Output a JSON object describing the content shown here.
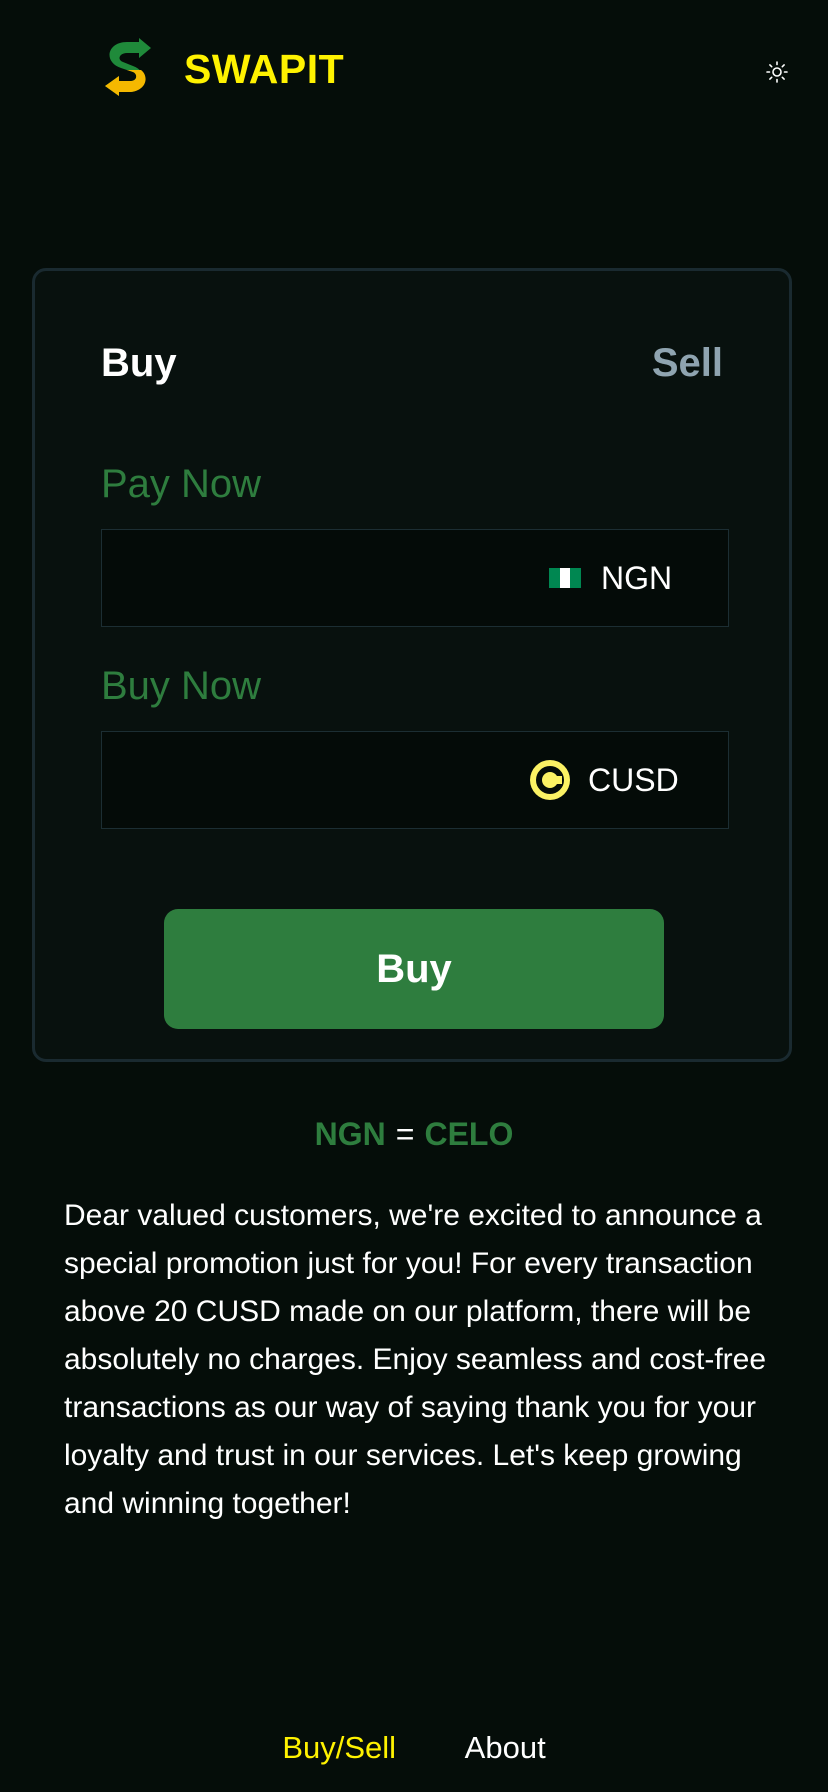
{
  "header": {
    "brand": "SWAPIT",
    "logo_icon": "swap-s-logo-icon",
    "theme_icon": "sun-icon"
  },
  "tabs": [
    {
      "label": "Buy",
      "active": true
    },
    {
      "label": "Sell",
      "active": false
    }
  ],
  "pay_field": {
    "label": "Pay Now",
    "value": "",
    "currency": "NGN",
    "currency_icon": "nigeria-flag-icon"
  },
  "receive_field": {
    "label": "Buy Now",
    "value": "",
    "currency": "CUSD",
    "currency_icon": "cusd-coin-icon"
  },
  "action_button": {
    "label": "Buy"
  },
  "rate": {
    "from": "NGN",
    "equals": "=",
    "to": "CELO"
  },
  "promo_text": "Dear valued customers, we're excited to announce a special promotion just for you! For every transaction above 20 CUSD made on our platform, there will be absolutely no charges. Enjoy seamless and cost-free transactions as our way of saying thank you for your loyalty and trust in our services. Let's keep growing and winning together!",
  "footer_nav": [
    {
      "label": "Buy/Sell",
      "active": true
    },
    {
      "label": "About",
      "active": false
    }
  ],
  "colors": {
    "background": "#050d09",
    "accent_yellow": "#fff200",
    "accent_green": "#2e7d3e",
    "inactive_tab": "#8fa4b0"
  }
}
